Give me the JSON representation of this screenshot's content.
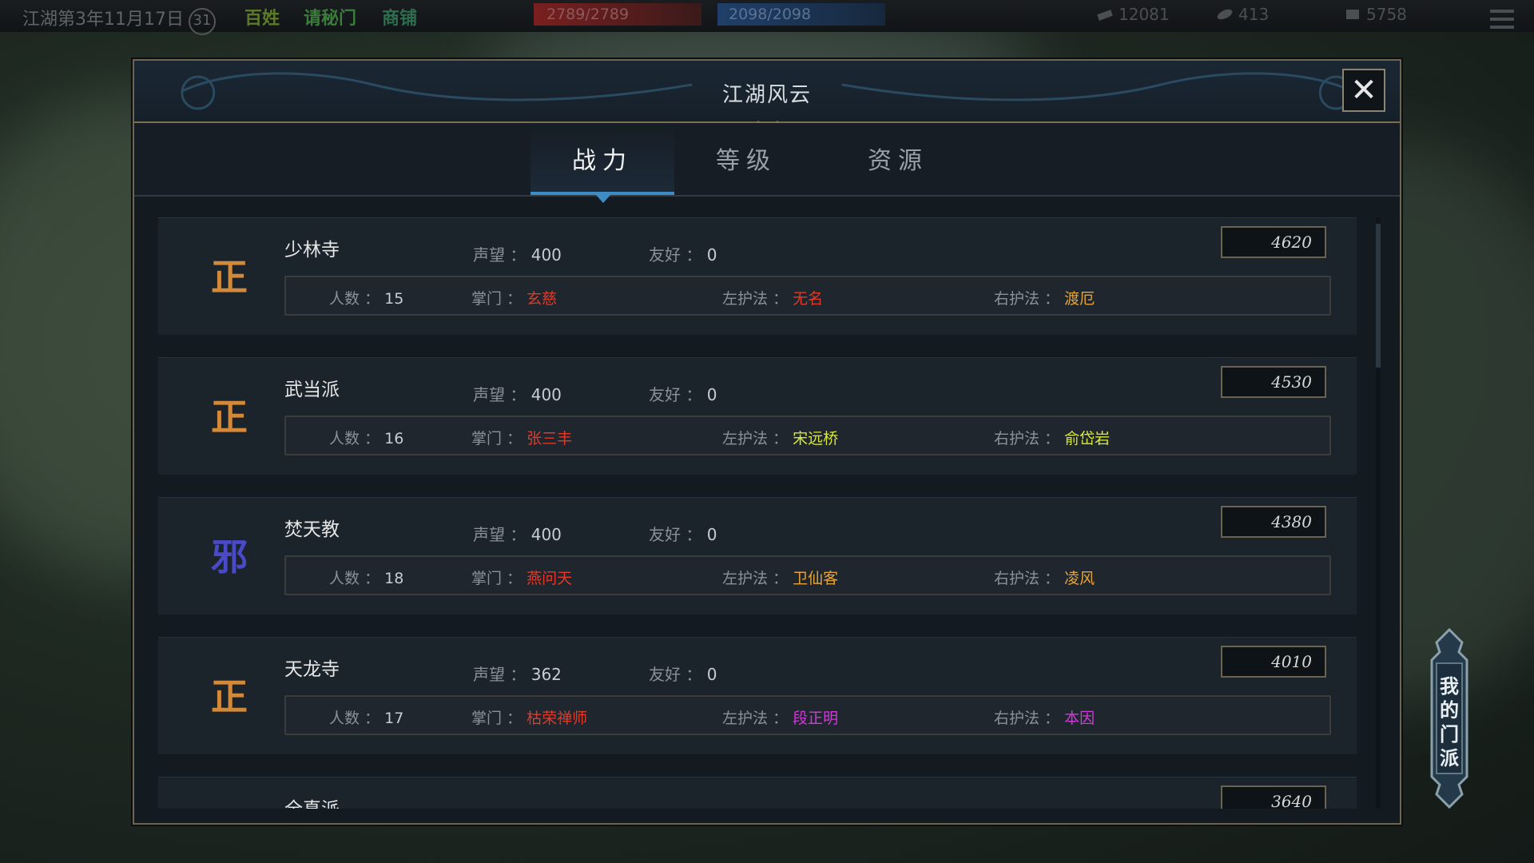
{
  "hud": {
    "date": "江湖第3年11月17日",
    "day_badge": "31",
    "tag1": "百姓",
    "tag2": "请秘门",
    "tag3": "商铺",
    "hp": "2789/2789",
    "mp": "2098/2098",
    "currency1": "12081",
    "currency2": "413",
    "currency3": "5758"
  },
  "panel": {
    "title": "江湖风云",
    "close": "✕"
  },
  "tabs": [
    {
      "label": "战力",
      "active": true
    },
    {
      "label": "等级",
      "active": false
    },
    {
      "label": "资源",
      "active": false
    }
  ],
  "labels": {
    "reputation": "声望",
    "friendship": "友好",
    "members": "人数",
    "leader": "掌门",
    "left_guard": "左护法",
    "right_guard": "右护法",
    "sep": "："
  },
  "sects": [
    {
      "name": "少林寺",
      "alignment": "正",
      "reputation": "400",
      "friendship": "0",
      "power": "4620",
      "members": "15",
      "leader": "玄慈",
      "leader_color": "#e23a2a",
      "left": "无名",
      "left_color": "#e23a2a",
      "right": "渡厄",
      "right_color": "#e6a43a"
    },
    {
      "name": "武当派",
      "alignment": "正",
      "reputation": "400",
      "friendship": "0",
      "power": "4530",
      "members": "16",
      "leader": "张三丰",
      "leader_color": "#e23a2a",
      "left": "宋远桥",
      "left_color": "#d8e83a",
      "right": "俞岱岩",
      "right_color": "#d8e83a"
    },
    {
      "name": "焚天教",
      "alignment": "邪",
      "reputation": "400",
      "friendship": "0",
      "power": "4380",
      "members": "18",
      "leader": "燕问天",
      "leader_color": "#e23a2a",
      "left": "卫仙客",
      "left_color": "#e6a43a",
      "right": "凌风",
      "right_color": "#e6a43a"
    },
    {
      "name": "天龙寺",
      "alignment": "正",
      "reputation": "362",
      "friendship": "0",
      "power": "4010",
      "members": "17",
      "leader": "枯荣禅师",
      "leader_color": "#e23a2a",
      "left": "段正明",
      "left_color": "#d03ad8",
      "right": "本因",
      "right_color": "#d03ad8"
    },
    {
      "name": "全真派",
      "alignment": "",
      "reputation": "",
      "friendship": "",
      "power": "3640",
      "members": "",
      "leader": "",
      "leader_color": "#e23a2a",
      "left": "",
      "left_color": "#e6a43a",
      "right": "",
      "right_color": "#e6a43a"
    }
  ],
  "colors": {
    "righteous": "#d28a3a",
    "evil": "#4a49c8"
  },
  "side_button": "我的门派"
}
